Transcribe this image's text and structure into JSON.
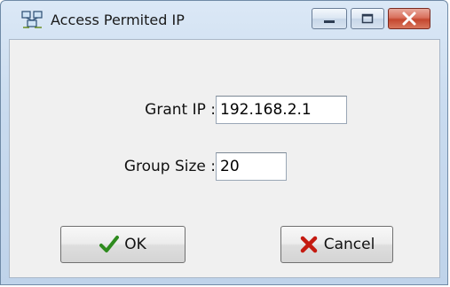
{
  "window": {
    "title": "Access Permited IP",
    "icon": "network-computers-icon"
  },
  "caption_buttons": {
    "minimize_icon": "minimize-icon",
    "maximize_icon": "maximize-icon",
    "close_icon": "close-icon"
  },
  "form": {
    "grant_ip_label": "Grant  IP :",
    "grant_ip_value": "192.168.2.1",
    "group_size_label": "Group Size :",
    "group_size_value": "20"
  },
  "buttons": {
    "ok_label": "OK",
    "ok_icon": "checkmark-icon",
    "cancel_label": "Cancel",
    "cancel_icon": "x-icon"
  },
  "colors": {
    "ok_check": "#2e8b1e",
    "cancel_x": "#c41a10",
    "close_button": "#c4472f"
  }
}
